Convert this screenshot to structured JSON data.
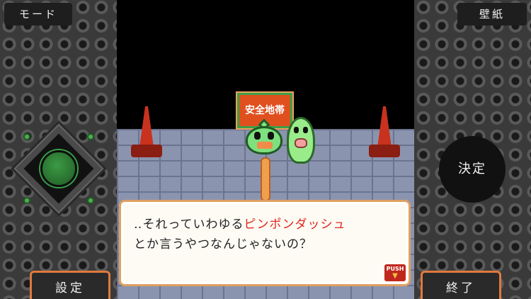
{
  "top_bar": {
    "mode_label": "モード",
    "wallpaper_label": "壁紙"
  },
  "controls": {
    "decide_label": "決定",
    "settings_label": "設定",
    "end_label": "終了"
  },
  "scene": {
    "sign_text": "安全地帯"
  },
  "dialog": {
    "line1_prefix": "‥それっていわゆる",
    "line1_highlight": "ピンポンダッシュ",
    "line2": "とか言うやつなんじゃないの？"
  },
  "push_indicator": {
    "label": "PUSH"
  },
  "colors": {
    "accent_orange": "#e07a3e",
    "highlight_red": "#e0281e",
    "knob_green": "#3c9a44"
  }
}
